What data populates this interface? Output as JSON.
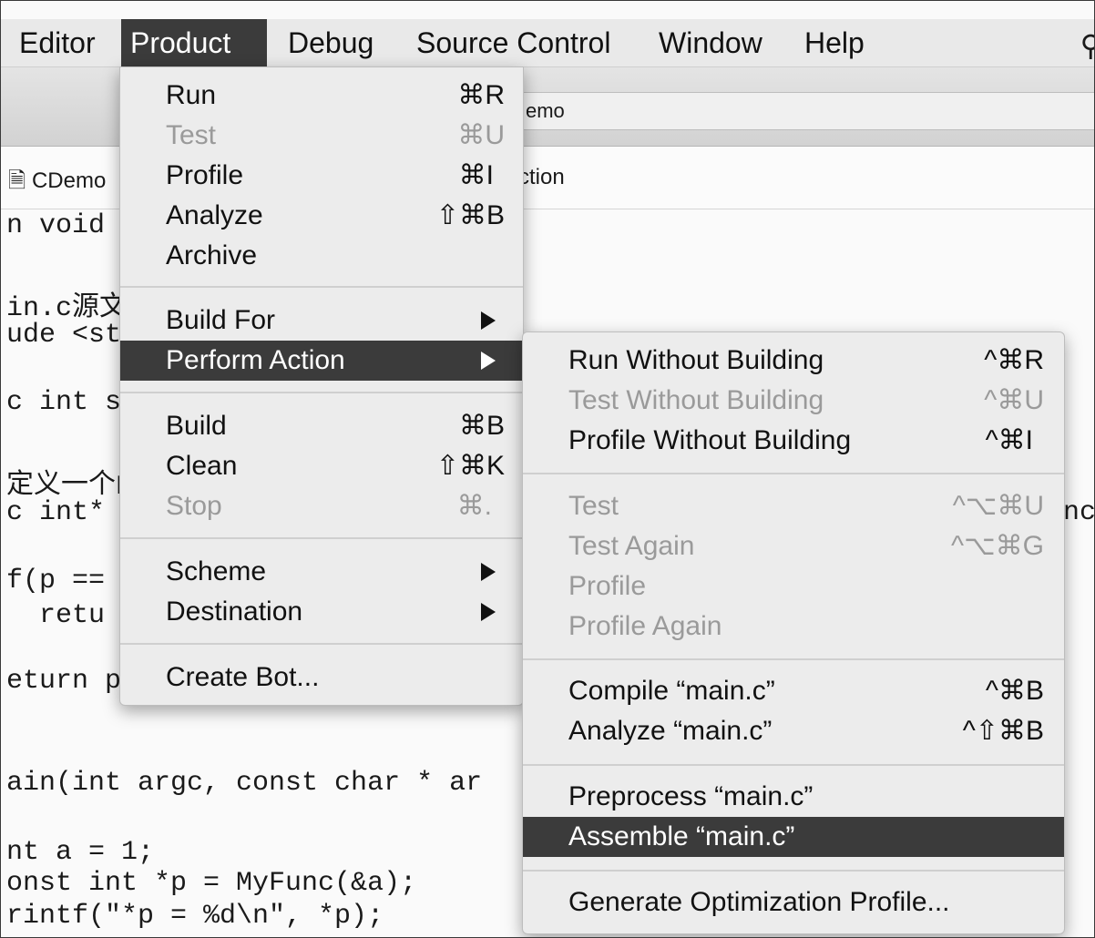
{
  "menubar": {
    "items": [
      {
        "label": "Editor"
      },
      {
        "label": "Product"
      },
      {
        "label": "Debug"
      },
      {
        "label": "Source Control"
      },
      {
        "label": "Window"
      },
      {
        "label": "Help"
      }
    ],
    "search_glyph": "Ρ"
  },
  "editor": {
    "scheme_text": "emo",
    "crumb_left": "CDemo",
    "crumb_right": "ction",
    "code_lines": [
      "n void",
      "in.c源文",
      "ude <st",
      "c int s",
      "定义一个函",
      "c int*",
      "f(p ==",
      "  retu",
      "eturn p",
      "ain(int argc, const char * ar",
      "nt a = 1;",
      "onst int *p = MyFunc(&a);",
      "rintf(\"*p = %d\\n\", *p);"
    ],
    "code_right_fragment": "nc"
  },
  "product_menu": {
    "items": [
      {
        "label": "Run",
        "shortcut": "⌘R"
      },
      {
        "label": "Test",
        "shortcut": "⌘U"
      },
      {
        "label": "Profile",
        "shortcut": "⌘I"
      },
      {
        "label": "Analyze",
        "shortcut": "⇧⌘B"
      },
      {
        "label": "Archive",
        "shortcut": ""
      },
      {
        "label": "Build For",
        "shortcut": ""
      },
      {
        "label": "Perform Action",
        "shortcut": ""
      },
      {
        "label": "Build",
        "shortcut": "⌘B"
      },
      {
        "label": "Clean",
        "shortcut": "⇧⌘K"
      },
      {
        "label": "Stop",
        "shortcut": "⌘."
      },
      {
        "label": "Scheme",
        "shortcut": ""
      },
      {
        "label": "Destination",
        "shortcut": ""
      },
      {
        "label": "Create Bot...",
        "shortcut": ""
      }
    ]
  },
  "action_menu": {
    "items": [
      {
        "label": "Run Without Building",
        "shortcut": "^⌘R"
      },
      {
        "label": "Test Without Building",
        "shortcut": "^⌘U"
      },
      {
        "label": "Profile Without Building",
        "shortcut": "^⌘I"
      },
      {
        "label": "Test",
        "shortcut": "^⌥⌘U"
      },
      {
        "label": "Test Again",
        "shortcut": "^⌥⌘G"
      },
      {
        "label": "Profile",
        "shortcut": ""
      },
      {
        "label": "Profile Again",
        "shortcut": ""
      },
      {
        "label": "Compile “main.c”",
        "shortcut": "^⌘B"
      },
      {
        "label": "Analyze “main.c”",
        "shortcut": "^⇧⌘B"
      },
      {
        "label": "Preprocess “main.c”",
        "shortcut": ""
      },
      {
        "label": "Assemble “main.c”",
        "shortcut": ""
      },
      {
        "label": "Generate Optimization Profile...",
        "shortcut": ""
      }
    ]
  }
}
